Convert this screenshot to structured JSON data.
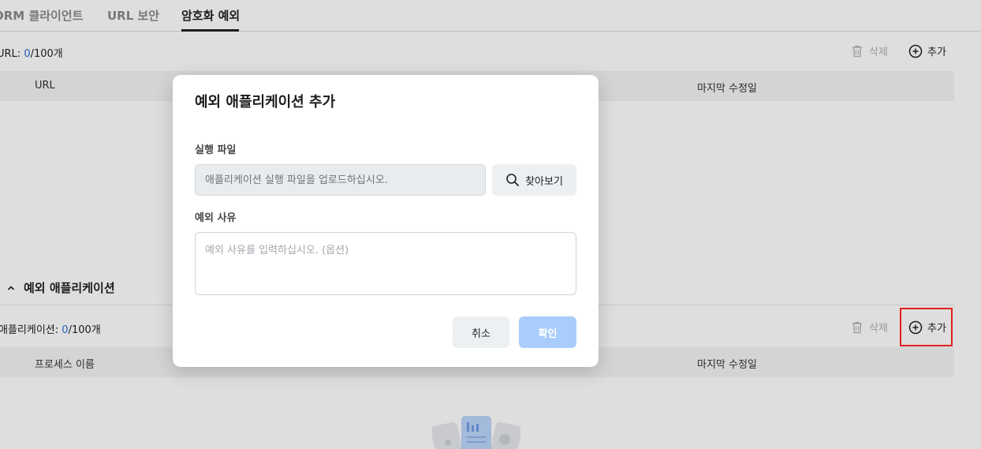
{
  "tabs": [
    {
      "label": "ORM 클라이언트"
    },
    {
      "label": "URL 보안"
    },
    {
      "label": "암호화 예외"
    }
  ],
  "url_section": {
    "count_label": "URL: ",
    "count_value": "0",
    "count_suffix": "/100개",
    "delete_label": "삭제",
    "add_label": "추가",
    "columns": [
      "URL",
      "마지막 수정일"
    ]
  },
  "app_section": {
    "title": "예외 애플리케이션",
    "count_label": "애플리케이션: ",
    "count_value": "0",
    "count_suffix": "/100개",
    "delete_label": "삭제",
    "add_label": "추가",
    "columns": [
      "프로세스 이름",
      "마지막 수정일"
    ]
  },
  "modal": {
    "title": "예외 애플리케이션 추가",
    "file_label": "실행 파일",
    "file_placeholder": "애플리케이션 실행 파일을 업로드하십시오.",
    "browse_label": "찾아보기",
    "reason_label": "예외 사유",
    "reason_placeholder": "예외 사유를 입력하십시오. (옵션)",
    "cancel_label": "취소",
    "confirm_label": "확인"
  },
  "colors": {
    "accent": "#2f6fd6",
    "confirm_disabled": "#a9cdfb",
    "highlight": "#e02020"
  }
}
